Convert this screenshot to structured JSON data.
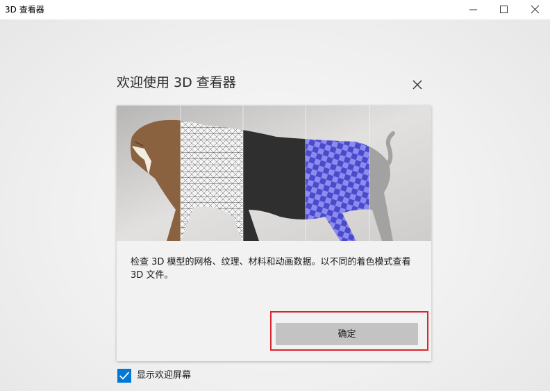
{
  "window": {
    "title": "3D 查看器",
    "controls": [
      "minimize-icon",
      "maximize-icon",
      "close-icon"
    ]
  },
  "dialog": {
    "title": "欢迎使用 3D 查看器",
    "close_icon": "close-icon",
    "hero_image": "model-render-tiger",
    "description": "检查 3D 模型的网格、纹理、材料和动画数据。以不同的着色模式查看 3D 文件。",
    "ok_label": "确定",
    "highlight_color": "#d9262e"
  },
  "footer": {
    "show_welcome_label": "显示欢迎屏幕",
    "show_welcome_checked": true,
    "checkbox_color": "#0078d7"
  }
}
